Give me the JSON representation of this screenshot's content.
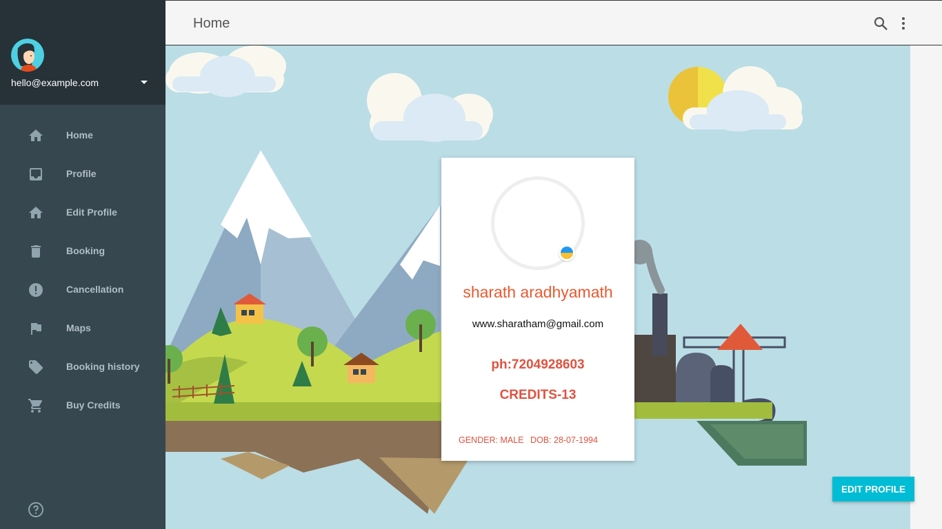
{
  "account": {
    "email": "hello@example.com"
  },
  "header": {
    "title": "Home"
  },
  "sidebar": {
    "items": [
      {
        "label": "Home",
        "icon": "home-icon"
      },
      {
        "label": "Profile",
        "icon": "inbox-icon"
      },
      {
        "label": "Edit Profile",
        "icon": "home-icon"
      },
      {
        "label": "Booking",
        "icon": "trash-icon"
      },
      {
        "label": "Cancellation",
        "icon": "alert-icon"
      },
      {
        "label": "Maps",
        "icon": "flag-icon"
      },
      {
        "label": "Booking history",
        "icon": "tag-icon"
      },
      {
        "label": "Buy Credits",
        "icon": "cart-icon"
      }
    ]
  },
  "profile": {
    "name": "sharath aradhyamath",
    "email": "www.sharatham@gmail.com",
    "phone": "ph:7204928603",
    "credits": "CREDITS-13",
    "gender": "GENDER: MALE",
    "dob": "DOB: 28-07-1994"
  },
  "actions": {
    "edit_profile": "EDIT PROFILE"
  },
  "colors": {
    "sidebar_bg": "#37474f",
    "sidebar_header_bg": "#263238",
    "accent": "#00bcd4",
    "name_color": "#e9582f",
    "info_color": "#e0523f",
    "sky": "#bbdde6"
  }
}
